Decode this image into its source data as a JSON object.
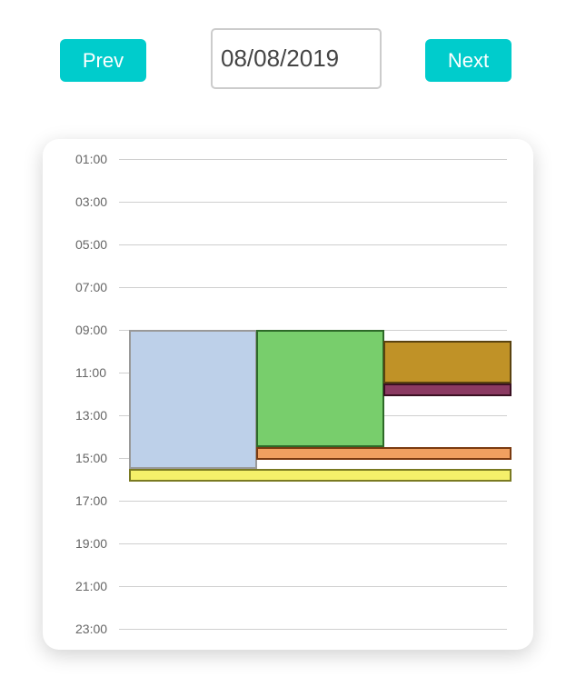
{
  "toolbar": {
    "prev_label": "Prev",
    "next_label": "Next",
    "date_value": "08/08/2019"
  },
  "colors": {
    "button_bg": "#00cccc",
    "button_text": "#ffffff"
  },
  "calendar": {
    "hours": [
      "01:00",
      "03:00",
      "05:00",
      "07:00",
      "09:00",
      "11:00",
      "13:00",
      "15:00",
      "17:00",
      "19:00",
      "21:00",
      "23:00"
    ],
    "events": [
      {
        "start": 9.0,
        "end": 15.5,
        "fill": "#bdd0e9",
        "border": "#999999"
      },
      {
        "start": 9.0,
        "end": 14.5,
        "fill": "#78ce6c",
        "border": "#2d6a28"
      },
      {
        "start": 9.5,
        "end": 11.5,
        "fill": "#c09227",
        "border": "#5a4310"
      },
      {
        "start": 11.5,
        "end": 12.1,
        "fill": "#8b3a62",
        "border": "#3a1022"
      },
      {
        "start": 14.5,
        "end": 15.1,
        "fill": "#f0a060",
        "border": "#7a3a10"
      },
      {
        "start": 15.5,
        "end": 16.1,
        "fill": "#f5f06a",
        "border": "#7a7a22"
      }
    ]
  }
}
